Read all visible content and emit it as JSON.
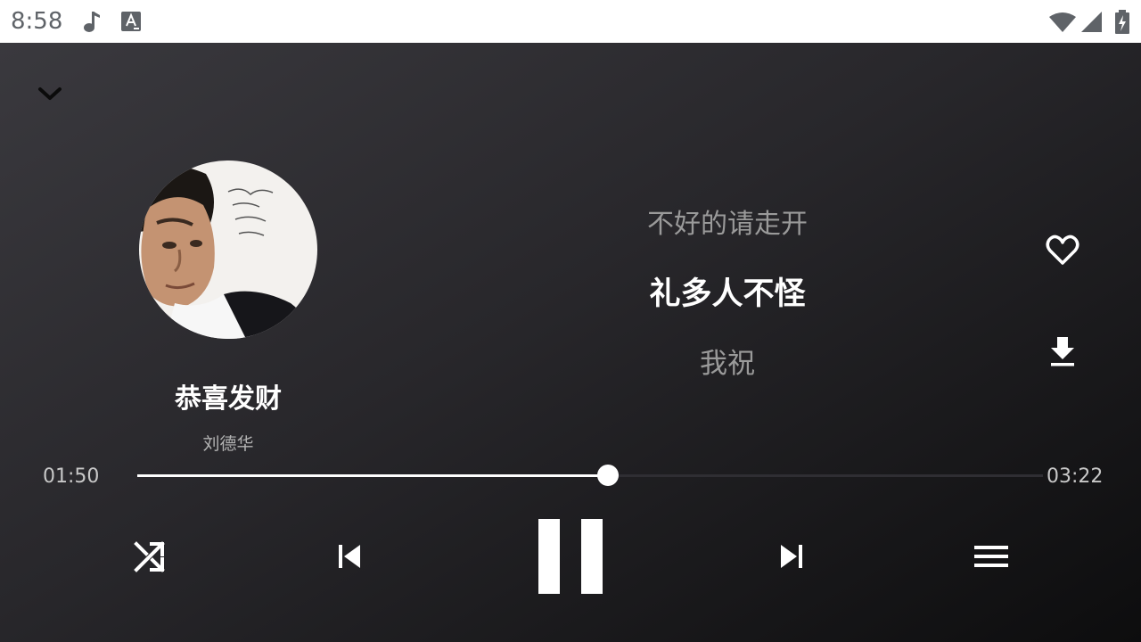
{
  "status_bar": {
    "time": "8:58",
    "icons": [
      "music-note-icon",
      "text-a-icon",
      "wifi-icon",
      "cell-signal-icon",
      "battery-charging-icon"
    ]
  },
  "player": {
    "song_title": "恭喜发财",
    "artist": "刘德华",
    "lyrics": {
      "previous": "不好的请走开",
      "current": "礼多人不怪",
      "next": "我祝"
    },
    "elapsed": "01:50",
    "duration": "03:22",
    "progress": 0.5198,
    "is_playing": true,
    "icons": {
      "collapse": "chevron-down-icon",
      "favorite": "heart-outline-icon",
      "download": "download-icon",
      "shuffle": "shuffle-icon",
      "previous": "skip-previous-icon",
      "play_pause": "pause-icon",
      "next": "skip-next-icon",
      "playlist": "menu-icon"
    }
  },
  "colors": {
    "background_start": "#3a393e",
    "background_end": "#0d0d0e",
    "accent": "#ffffff",
    "lyric_dim": "#9a9a9a"
  }
}
